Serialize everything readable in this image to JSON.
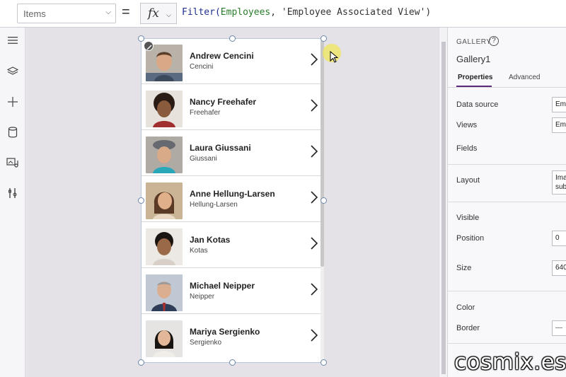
{
  "formula_bar": {
    "property": "Items",
    "equals": "=",
    "fx": "fx",
    "formula_func": "Filter(",
    "formula_arg1": "Employees",
    "formula_sep": ", ",
    "formula_arg2": "'Employee Associated View'",
    "formula_close": ")"
  },
  "left_rail": {
    "icons": [
      "menu-icon",
      "layers-icon",
      "add-icon",
      "data-icon",
      "media-icon",
      "tools-icon"
    ]
  },
  "gallery": {
    "items": [
      {
        "name": "Andrew Cencini",
        "subtitle": "Cencini"
      },
      {
        "name": "Nancy Freehafer",
        "subtitle": "Freehafer"
      },
      {
        "name": "Laura Giussani",
        "subtitle": "Giussani"
      },
      {
        "name": "Anne Hellung-Larsen",
        "subtitle": "Hellung-Larsen"
      },
      {
        "name": "Jan Kotas",
        "subtitle": "Kotas"
      },
      {
        "name": "Michael Neipper",
        "subtitle": "Neipper"
      },
      {
        "name": "Mariya Sergienko",
        "subtitle": "Sergienko"
      }
    ]
  },
  "properties_panel": {
    "control_type": "GALLERY",
    "control_name": "Gallery1",
    "tabs": {
      "properties": "Properties",
      "advanced": "Advanced"
    },
    "labels": {
      "data_source": "Data source",
      "views": "Views",
      "fields": "Fields",
      "layout": "Layout",
      "visible": "Visible",
      "position": "Position",
      "size": "Size",
      "color": "Color",
      "border": "Border"
    },
    "values": {
      "data_source": "Emp",
      "views": "Emp",
      "layout_line1": "Ima",
      "layout_line2": "sub",
      "position": "0",
      "size": "640",
      "border": "—"
    }
  },
  "colors": {
    "accent": "#5b2a7a",
    "selection": "#6a86a8",
    "formula_text": "#1f2f8f"
  },
  "watermark": "cosmix.es"
}
